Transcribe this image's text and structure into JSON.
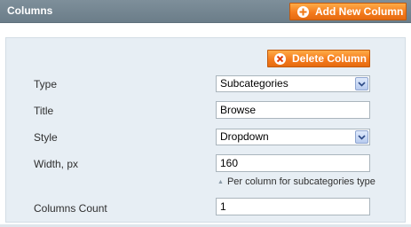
{
  "header": {
    "title": "Columns",
    "add_button_label": "Add New Column"
  },
  "panel": {
    "delete_button_label": "Delete Column",
    "fields": {
      "type": {
        "label": "Type",
        "value": "Subcategories"
      },
      "title": {
        "label": "Title",
        "value": "Browse"
      },
      "style": {
        "label": "Style",
        "value": "Dropdown"
      },
      "width": {
        "label": "Width, px",
        "value": "160",
        "hint": "Per column for subcategories type"
      },
      "columns_count": {
        "label": "Columns Count",
        "value": "1"
      }
    }
  },
  "colors": {
    "header_bg": "#6b7d89",
    "button_orange": "#f57c1e",
    "panel_bg": "#e7eef4"
  },
  "icons": {
    "add": "plus-circle-icon",
    "delete": "x-circle-icon",
    "dropdown": "chevron-down-icon",
    "hint": "triangle-up-icon"
  }
}
